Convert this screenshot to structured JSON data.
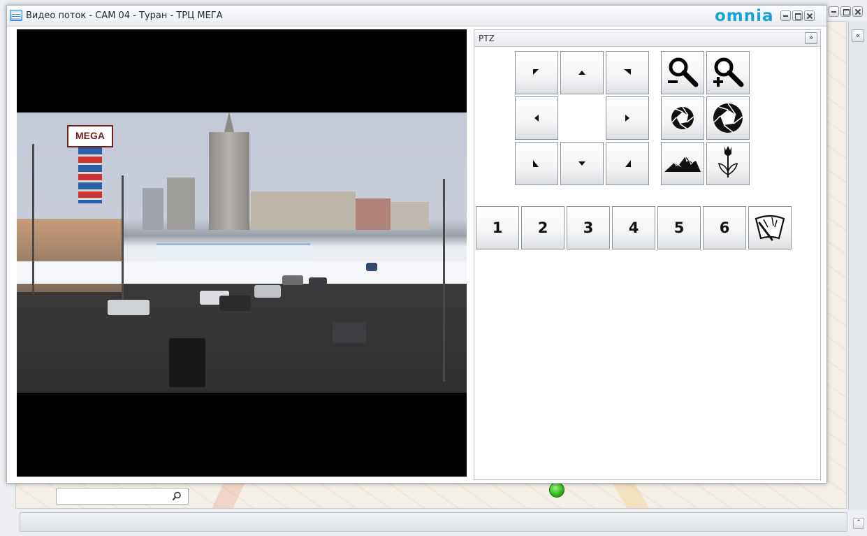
{
  "window": {
    "title": "Видео поток - CAM 04 - Туран - ТРЦ МЕГА",
    "brand": "omnia",
    "brand_color": "#19a3d6",
    "controls": [
      "minimize-icon",
      "maximize-icon",
      "close-icon"
    ]
  },
  "video": {
    "camera": "CAM 04",
    "overlay_sign": "MEGA"
  },
  "ptz": {
    "title": "PTZ",
    "collapse_label": "»",
    "directions": [
      "up-left",
      "up",
      "up-right",
      "left",
      "right",
      "down-left",
      "down",
      "down-right"
    ],
    "zoom": [
      "zoom-out-icon",
      "zoom-in-icon"
    ],
    "iris": [
      "iris-close-icon",
      "iris-open-icon"
    ],
    "focus": [
      "focus-far-icon",
      "focus-near-icon"
    ],
    "presets": [
      "1",
      "2",
      "3",
      "4",
      "5",
      "6"
    ],
    "wiper_icon": "wiper-icon"
  },
  "background": {
    "sidebar_collapse_label": "«",
    "status_expand_label": "⌃",
    "search_placeholder": "",
    "search_icon": "magnifier-icon"
  }
}
